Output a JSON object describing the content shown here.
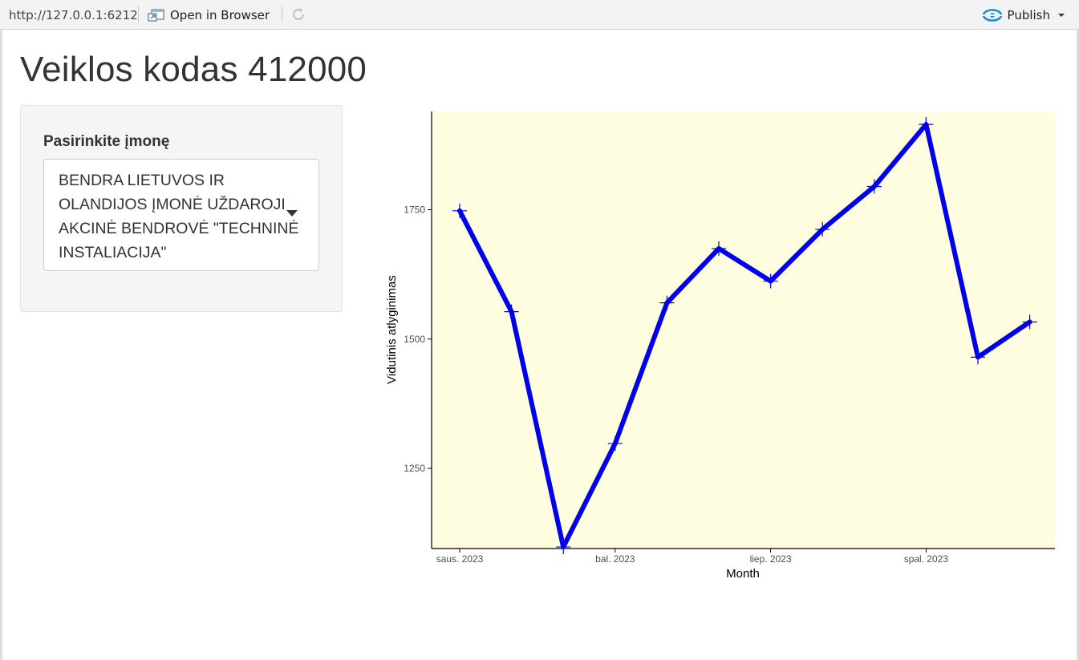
{
  "toolbar": {
    "url": "http://127.0.0.1:6212",
    "open_in_browser_label": "Open in Browser",
    "publish_label": "Publish",
    "icons": [
      "open-in-browser-icon",
      "refresh-icon",
      "publish-icon",
      "chevron-down-icon"
    ]
  },
  "page": {
    "title": "Veiklos kodas 412000"
  },
  "sidebar": {
    "select_label": "Pasirinkite įmonę",
    "selected_value": "BENDRA LIETUVOS IR OLANDIJOS ĮMONĖ UŽDAROJI AKCINĖ BENDROVĖ \"TECHNINĖ INSTALIACIJA\""
  },
  "colors": {
    "line": "#0000ee",
    "panel_background": "#fffde0",
    "accent_publish": "#1a8fd8"
  },
  "chart_data": {
    "type": "line",
    "xlabel": "Month",
    "ylabel": "Vidutinis atlyginimas",
    "x_tick_labels": [
      "saus. 2023",
      "bal. 2023",
      "liep. 2023",
      "spal. 2023"
    ],
    "y_ticks": [
      1250,
      1500,
      1750
    ],
    "ylim": [
      1095,
      1940
    ],
    "x": [
      "2023-01",
      "2023-02",
      "2023-03",
      "2023-04",
      "2023-05",
      "2023-06",
      "2023-07",
      "2023-08",
      "2023-09",
      "2023-10",
      "2023-11",
      "2023-12"
    ],
    "values": [
      1748,
      1553,
      1098,
      1298,
      1570,
      1675,
      1612,
      1712,
      1795,
      1915,
      1465,
      1533
    ],
    "grid": false,
    "marker": "cross"
  }
}
